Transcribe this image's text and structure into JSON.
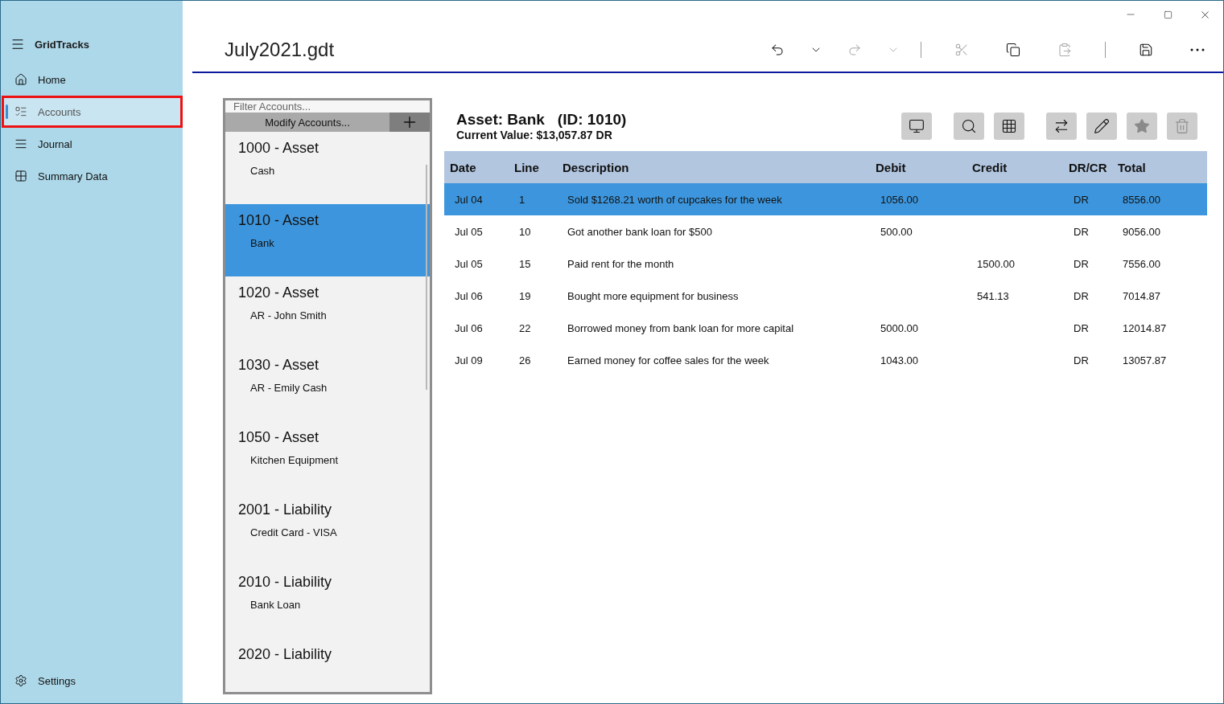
{
  "app": {
    "name": "GridTracks"
  },
  "nav": [
    {
      "label": "Home",
      "selected": false
    },
    {
      "label": "Accounts",
      "selected": true
    },
    {
      "label": "Journal",
      "selected": false
    },
    {
      "label": "Summary Data",
      "selected": false
    }
  ],
  "settings": {
    "label": "Settings"
  },
  "document": {
    "title": "July2021.gdt"
  },
  "commands": [
    {
      "kind": "undo",
      "disabled": false
    },
    {
      "kind": "caret",
      "disabled": false
    },
    {
      "kind": "redo",
      "disabled": true
    },
    {
      "kind": "caret",
      "disabled": true
    },
    {
      "kind": "divider"
    },
    {
      "kind": "cut",
      "disabled": true
    },
    {
      "kind": "copy",
      "disabled": false
    },
    {
      "kind": "paste",
      "disabled": true
    },
    {
      "kind": "divider"
    },
    {
      "kind": "save",
      "disabled": false
    },
    {
      "kind": "more",
      "disabled": false
    }
  ],
  "accounts_panel": {
    "filter_placeholder": "Filter Accounts...",
    "modify_label": "Modify Accounts...",
    "items": [
      {
        "title": "1000 - Asset",
        "name": "Cash",
        "selected": false
      },
      {
        "title": "1010 - Asset",
        "name": "Bank",
        "selected": true
      },
      {
        "title": "1020 - Asset",
        "name": "AR - John Smith",
        "selected": false
      },
      {
        "title": "1030 - Asset",
        "name": "AR - Emily Cash",
        "selected": false
      },
      {
        "title": "1050 - Asset",
        "name": "Kitchen Equipment",
        "selected": false
      },
      {
        "title": "2001 - Liability",
        "name": "Credit Card - VISA",
        "selected": false
      },
      {
        "title": "2010 - Liability",
        "name": "Bank Loan",
        "selected": false
      },
      {
        "title": "2020 - Liability",
        "selected": false
      }
    ]
  },
  "account": {
    "heading": "Asset: Bank",
    "id": "(ID: 1010)",
    "current_value": "Current Value: $13,057.87 DR"
  },
  "actions": [
    {
      "kind": "monitor",
      "disabled": false
    },
    {
      "kind": "search",
      "disabled": false
    },
    {
      "kind": "grid",
      "disabled": false
    },
    {
      "kind": "transfer",
      "disabled": false
    },
    {
      "kind": "edit",
      "disabled": false
    },
    {
      "kind": "star",
      "disabled": true
    },
    {
      "kind": "delete",
      "disabled": true
    }
  ],
  "table": {
    "columns": [
      "Date",
      "Line",
      "Description",
      "Debit",
      "Credit",
      "DR/CR",
      "Total"
    ],
    "rows": [
      {
        "cells": [
          "Jul 04",
          "1",
          "Sold $1268.21 worth of cupcakes for the week",
          "1056.00",
          "",
          "DR",
          "8556.00"
        ],
        "selected": true
      },
      {
        "cells": [
          "Jul 05",
          "10",
          "Got another bank loan for $500",
          "500.00",
          "",
          "DR",
          "9056.00"
        ],
        "selected": false
      },
      {
        "cells": [
          "Jul 05",
          "15",
          "Paid rent for the month",
          "",
          "1500.00",
          "DR",
          "7556.00"
        ],
        "selected": false
      },
      {
        "cells": [
          "Jul 06",
          "19",
          "Bought more equipment for business",
          "",
          "541.13",
          "DR",
          "7014.87"
        ],
        "selected": false
      },
      {
        "cells": [
          "Jul 06",
          "22",
          "Borrowed money from bank loan for more capital",
          "5000.00",
          "",
          "DR",
          "12014.87"
        ],
        "selected": false
      },
      {
        "cells": [
          "Jul 09",
          "26",
          "Earned money for coffee sales for the week",
          "1043.00",
          "",
          "DR",
          "13057.87"
        ],
        "selected": false
      }
    ]
  }
}
